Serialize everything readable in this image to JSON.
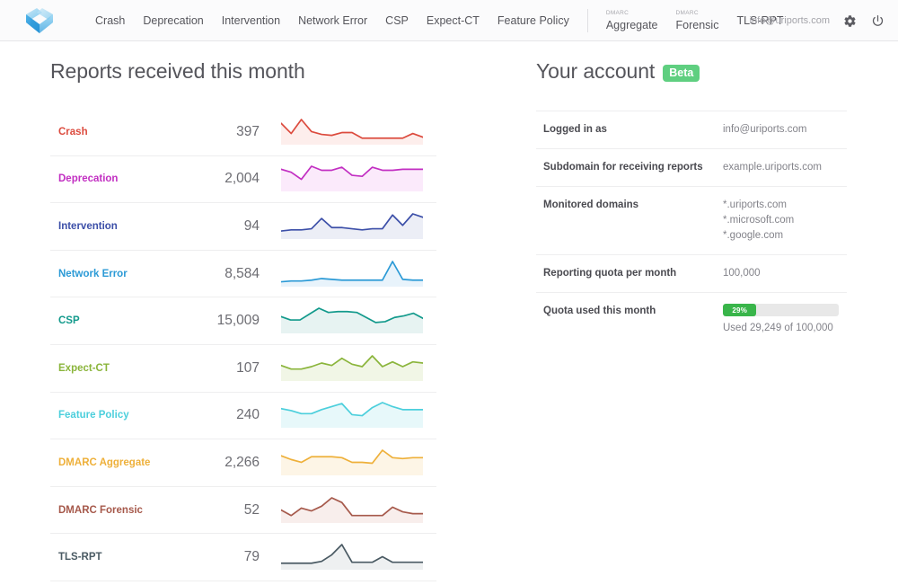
{
  "topbar": {
    "logo_name": "uriports-logo",
    "nav_items": [
      {
        "label": "Crash",
        "sub": ""
      },
      {
        "label": "Deprecation",
        "sub": ""
      },
      {
        "label": "Intervention",
        "sub": ""
      },
      {
        "label": "Network Error",
        "sub": ""
      },
      {
        "label": "CSP",
        "sub": ""
      },
      {
        "label": "Expect-CT",
        "sub": ""
      },
      {
        "label": "Feature Policy",
        "sub": ""
      }
    ],
    "nav_items_right": [
      {
        "label": "Aggregate",
        "sub": "DMARC"
      },
      {
        "label": "Forensic",
        "sub": "DMARC"
      },
      {
        "label": "TLS-RPT",
        "sub": ""
      }
    ],
    "user_email": "info@uriports.com",
    "settings_icon": "gear-icon",
    "logout_icon": "power-icon"
  },
  "reports": {
    "title": "Reports received this month",
    "rows": [
      {
        "name": "Crash",
        "count": "397",
        "color": "#dc4b3e",
        "fill": "#fdeeec"
      },
      {
        "name": "Deprecation",
        "count": "2,004",
        "color": "#c22fc2",
        "fill": "#fbeafb"
      },
      {
        "name": "Intervention",
        "count": "94",
        "color": "#3c4fa8",
        "fill": "#eceef6"
      },
      {
        "name": "Network Error",
        "count": "8,584",
        "color": "#2b9ad6",
        "fill": "#e8f3fb"
      },
      {
        "name": "CSP",
        "count": "15,009",
        "color": "#139a8c",
        "fill": "#e7f3f2"
      },
      {
        "name": "Expect-CT",
        "count": "107",
        "color": "#8bb53c",
        "fill": "#f1f6e6"
      },
      {
        "name": "Feature Policy",
        "count": "240",
        "color": "#4ccfdc",
        "fill": "#e7f8fa"
      },
      {
        "name": "DMARC Aggregate",
        "count": "2,266",
        "color": "#eeb03a",
        "fill": "#fdf5e6"
      },
      {
        "name": "DMARC Forensic",
        "count": "52",
        "color": "#a6594b",
        "fill": "#f8eeec"
      },
      {
        "name": "TLS-RPT",
        "count": "79",
        "color": "#4a5a63",
        "fill": "#eef0f1"
      }
    ]
  },
  "chart_data": [
    {
      "type": "line",
      "title": "Crash",
      "values": [
        23,
        12,
        27,
        14,
        11,
        10,
        13,
        13,
        7,
        7,
        7,
        7,
        7,
        12,
        8
      ]
    },
    {
      "type": "line",
      "title": "Deprecation",
      "values": [
        22,
        19,
        12,
        25,
        21,
        21,
        24,
        16,
        15,
        24,
        21,
        21,
        22,
        22,
        22
      ]
    },
    {
      "type": "line",
      "title": "Intervention",
      "values": [
        7,
        8,
        8,
        9,
        18,
        10,
        10,
        9,
        8,
        9,
        9,
        21,
        12,
        22,
        19
      ]
    },
    {
      "type": "line",
      "title": "Network Error",
      "values": [
        6,
        7,
        7,
        8,
        10,
        9,
        8,
        8,
        8,
        8,
        8,
        31,
        9,
        8,
        8
      ]
    },
    {
      "type": "line",
      "title": "CSP",
      "values": [
        20,
        16,
        16,
        23,
        30,
        25,
        26,
        26,
        25,
        19,
        13,
        14,
        19,
        21,
        24,
        18
      ]
    },
    {
      "type": "line",
      "title": "Expect-CT",
      "values": [
        13,
        10,
        10,
        12,
        15,
        13,
        19,
        14,
        12,
        21,
        12,
        16,
        12,
        16,
        15
      ]
    },
    {
      "type": "line",
      "title": "Feature Policy",
      "values": [
        19,
        17,
        14,
        14,
        18,
        21,
        24,
        13,
        12,
        20,
        25,
        21,
        18,
        18,
        18
      ]
    },
    {
      "type": "line",
      "title": "DMARC Aggregate",
      "values": [
        21,
        17,
        14,
        20,
        20,
        20,
        19,
        14,
        14,
        13,
        27,
        19,
        18,
        19,
        19
      ]
    },
    {
      "type": "line",
      "title": "DMARC Forensic",
      "values": [
        14,
        8,
        16,
        13,
        18,
        27,
        22,
        8,
        8,
        8,
        8,
        17,
        12,
        10,
        10
      ]
    },
    {
      "type": "line",
      "title": "TLS-RPT",
      "values": [
        7,
        7,
        7,
        7,
        9,
        16,
        27,
        8,
        8,
        8,
        14,
        8,
        8,
        8,
        8
      ]
    }
  ],
  "account": {
    "title": "Your account",
    "badge": "Beta",
    "rows": [
      {
        "label": "Logged in as",
        "values": [
          "info@uriports.com"
        ]
      },
      {
        "label": "Subdomain for receiving reports",
        "values": [
          "example.uriports.com"
        ]
      },
      {
        "label": "Monitored domains",
        "values": [
          "*.uriports.com",
          "*.microsoft.com",
          "*.google.com"
        ]
      },
      {
        "label": "Reporting quota per month",
        "values": [
          "100,000"
        ]
      }
    ],
    "quota": {
      "label": "Quota used this month",
      "percent_text": "29%",
      "percent": 29,
      "used_text": "Used 29,249 of 100,000",
      "bar_color": "#39b54a",
      "track_color": "#e8e8e8"
    }
  }
}
